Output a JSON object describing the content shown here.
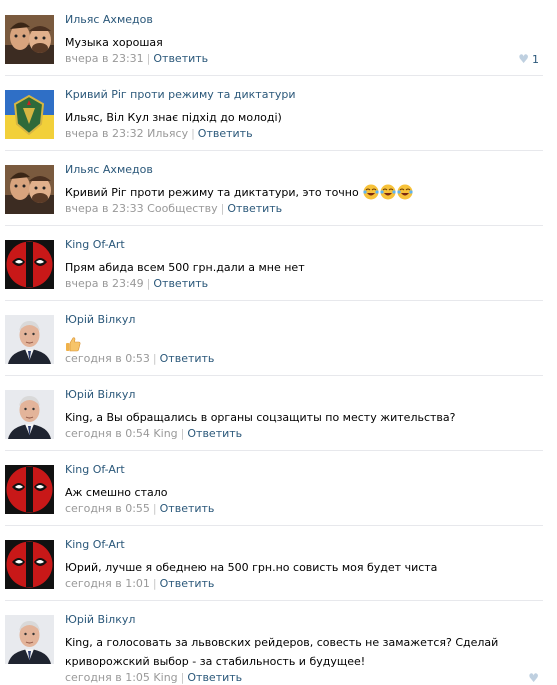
{
  "comments": [
    {
      "author": "Ильяс Ахмедов",
      "text": "Музыка хорошая",
      "time": "вчера в 23:31",
      "to": "",
      "reply": "Ответить",
      "likes": "1",
      "avatar": "selfie-photo"
    },
    {
      "author": "Кривий Ріг проти режиму та диктатури",
      "text": "Ильяс, Віл Кул знає підхід до молоді)",
      "time": "вчера в 23:32",
      "to": "Ильясу",
      "reply": "Ответить",
      "likes": "",
      "avatar": "coat-of-arms-flag"
    },
    {
      "author": "Ильяс Ахмедов",
      "text": "Кривий Ріг проти режиму та диктатури, это точно",
      "time": "вчера в 23:33",
      "to": "Сообществу",
      "reply": "Ответить",
      "likes": "",
      "avatar": "selfie-photo",
      "emoji": "laughing-tears-icon"
    },
    {
      "author": "King Of-Art",
      "text": "Прям абида всем 500 грн.дали а мне нет",
      "time": "вчера в 23:49",
      "to": "",
      "reply": "Ответить",
      "likes": "",
      "avatar": "deadpool-mask"
    },
    {
      "author": "Юрій Вілкул",
      "text": "",
      "time": "сегодня в 0:53",
      "to": "",
      "reply": "Ответить",
      "likes": "",
      "avatar": "portrait-photo",
      "thumb": "thumbs-up-icon"
    },
    {
      "author": "Юрій Вілкул",
      "text": "King, а Вы обращались в органы соцзащиты по месту жительства?",
      "time": "сегодня в 0:54",
      "to": "King",
      "reply": "Ответить",
      "likes": "",
      "avatar": "portrait-photo"
    },
    {
      "author": "King Of-Art",
      "text": "Аж смешно стало",
      "time": "сегодня в 0:55",
      "to": "",
      "reply": "Ответить",
      "likes": "",
      "avatar": "deadpool-mask"
    },
    {
      "author": "King Of-Art",
      "text": "Юрий, лучше я обеднею на 500 грн.но совисть моя будет чиста",
      "time": "сегодня в 1:01",
      "to": "",
      "reply": "Ответить",
      "likes": "",
      "avatar": "deadpool-mask"
    },
    {
      "author": "Юрій Вілкул",
      "text": "King, а голосовать за львовских рейдеров, совесть не замажется? Сделай криворожский выбор - за стабильность и будущее!",
      "time": "сегодня в 1:05",
      "to": "King",
      "reply": "Ответить",
      "likes": "",
      "avatar": "portrait-photo"
    }
  ],
  "colors": {
    "link": "#2b587a",
    "meta": "#999999",
    "separator": "#e7e8ec",
    "like_heart": "#bfd0e0"
  }
}
